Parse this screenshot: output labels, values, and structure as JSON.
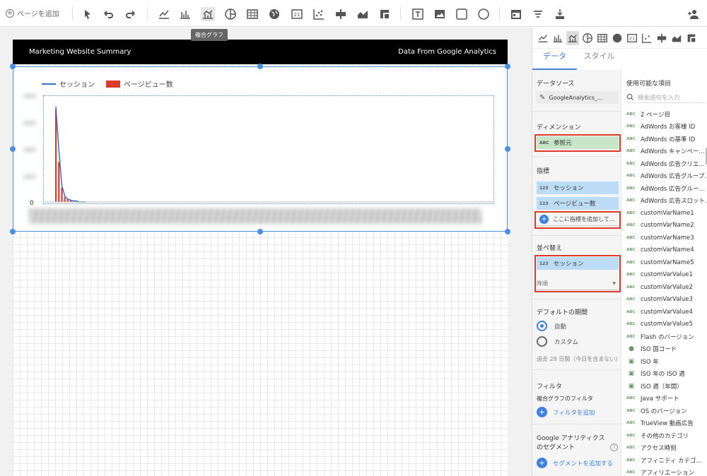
{
  "toolbar": {
    "add_page_label": "ページを追加",
    "tooltip": "複合グラフ"
  },
  "page": {
    "header_left": "Marketing Website Summary",
    "header_right": "Data From Google Analytics"
  },
  "chart_data": {
    "type": "bar",
    "title": "",
    "legend": [
      "セッション",
      "ページビュー数"
    ],
    "legend_position": "top-left",
    "y_tick_visible": "0",
    "series": [
      {
        "name": "セッション",
        "kind": "line",
        "values": [
          100,
          55,
          18,
          6,
          3,
          2,
          1,
          1,
          0,
          0,
          0
        ]
      },
      {
        "name": "ページビュー数",
        "kind": "bar",
        "values": [
          97,
          42,
          15,
          5,
          3,
          2,
          1,
          1,
          0,
          0,
          0
        ]
      }
    ],
    "categories": [
      "",
      "",
      "",
      "",
      "",
      "",
      "",
      "",
      "",
      "",
      ""
    ],
    "colors": {
      "line": "#3b6fc7",
      "bar": "#d93a2b"
    },
    "grid": true
  },
  "panel": {
    "tabs": [
      "データ",
      "スタイル"
    ],
    "data_source_title": "データソース",
    "data_source_value": "GoogleAnalytics_...",
    "dimension_title": "ディメンション",
    "dimension_value": "参照元",
    "metrics_title": "指標",
    "metrics": [
      "セッション",
      "ページビュー数"
    ],
    "add_metric": "ここに指標を追加して...",
    "sort_title": "並べ替え",
    "sort_value": "セッション",
    "sort_order": "降順",
    "date_range_title": "デフォルトの期間",
    "date_auto": "自動",
    "date_custom": "カスタム",
    "date_note": "過去 28 日間（今日を含まない）",
    "filter_title": "フィルタ",
    "filter_sub": "複合グラフのフィルタ",
    "add_filter": "フィルタを追加",
    "segment_title": "Google アナリティクスのセグメント",
    "add_segment": "セグメントを追加する",
    "tag_abc": "ABC",
    "tag_123": "123"
  },
  "available": {
    "title": "使用可能な項目",
    "search_placeholder": "検索語句を入力",
    "fields": [
      {
        "type": "abc",
        "label": "2 ページ目"
      },
      {
        "type": "abc",
        "label": "AdWords お客様 ID"
      },
      {
        "type": "abc",
        "label": "AdWords の基準 ID"
      },
      {
        "type": "abc",
        "label": "AdWords キャンペー..."
      },
      {
        "type": "abc",
        "label": "AdWords 広告クリエ..."
      },
      {
        "type": "abc",
        "label": "AdWords 広告グループ..."
      },
      {
        "type": "abc",
        "label": "AdWords 広告グルー..."
      },
      {
        "type": "abc",
        "label": "AdWords 広告スロット..."
      },
      {
        "type": "abc",
        "label": "customVarName1"
      },
      {
        "type": "abc",
        "label": "customVarName2"
      },
      {
        "type": "abc",
        "label": "customVarName3"
      },
      {
        "type": "abc",
        "label": "customVarName4"
      },
      {
        "type": "abc",
        "label": "customVarName5"
      },
      {
        "type": "abc",
        "label": "customVarValue1"
      },
      {
        "type": "abc",
        "label": "customVarValue2"
      },
      {
        "type": "abc",
        "label": "customVarValue3"
      },
      {
        "type": "abc",
        "label": "customVarValue4"
      },
      {
        "type": "abc",
        "label": "customVarValue5"
      },
      {
        "type": "abc",
        "label": "Flash のバージョン"
      },
      {
        "type": "globe",
        "label": "ISO 国コード"
      },
      {
        "type": "cal",
        "label": "ISO 年"
      },
      {
        "type": "cal",
        "label": "ISO 年の ISO 週"
      },
      {
        "type": "cal",
        "label": "ISO 週（年間）"
      },
      {
        "type": "abc",
        "label": "Java サポート"
      },
      {
        "type": "abc",
        "label": "OS のバージョン"
      },
      {
        "type": "abc",
        "label": "TrueView 動画広告"
      },
      {
        "type": "abc",
        "label": "その他のカテゴリ"
      },
      {
        "type": "abc",
        "label": "アクセス時刻"
      },
      {
        "type": "abc",
        "label": "アフィニティ カテゴ..."
      },
      {
        "type": "abc",
        "label": "アフィリエーション"
      }
    ]
  }
}
